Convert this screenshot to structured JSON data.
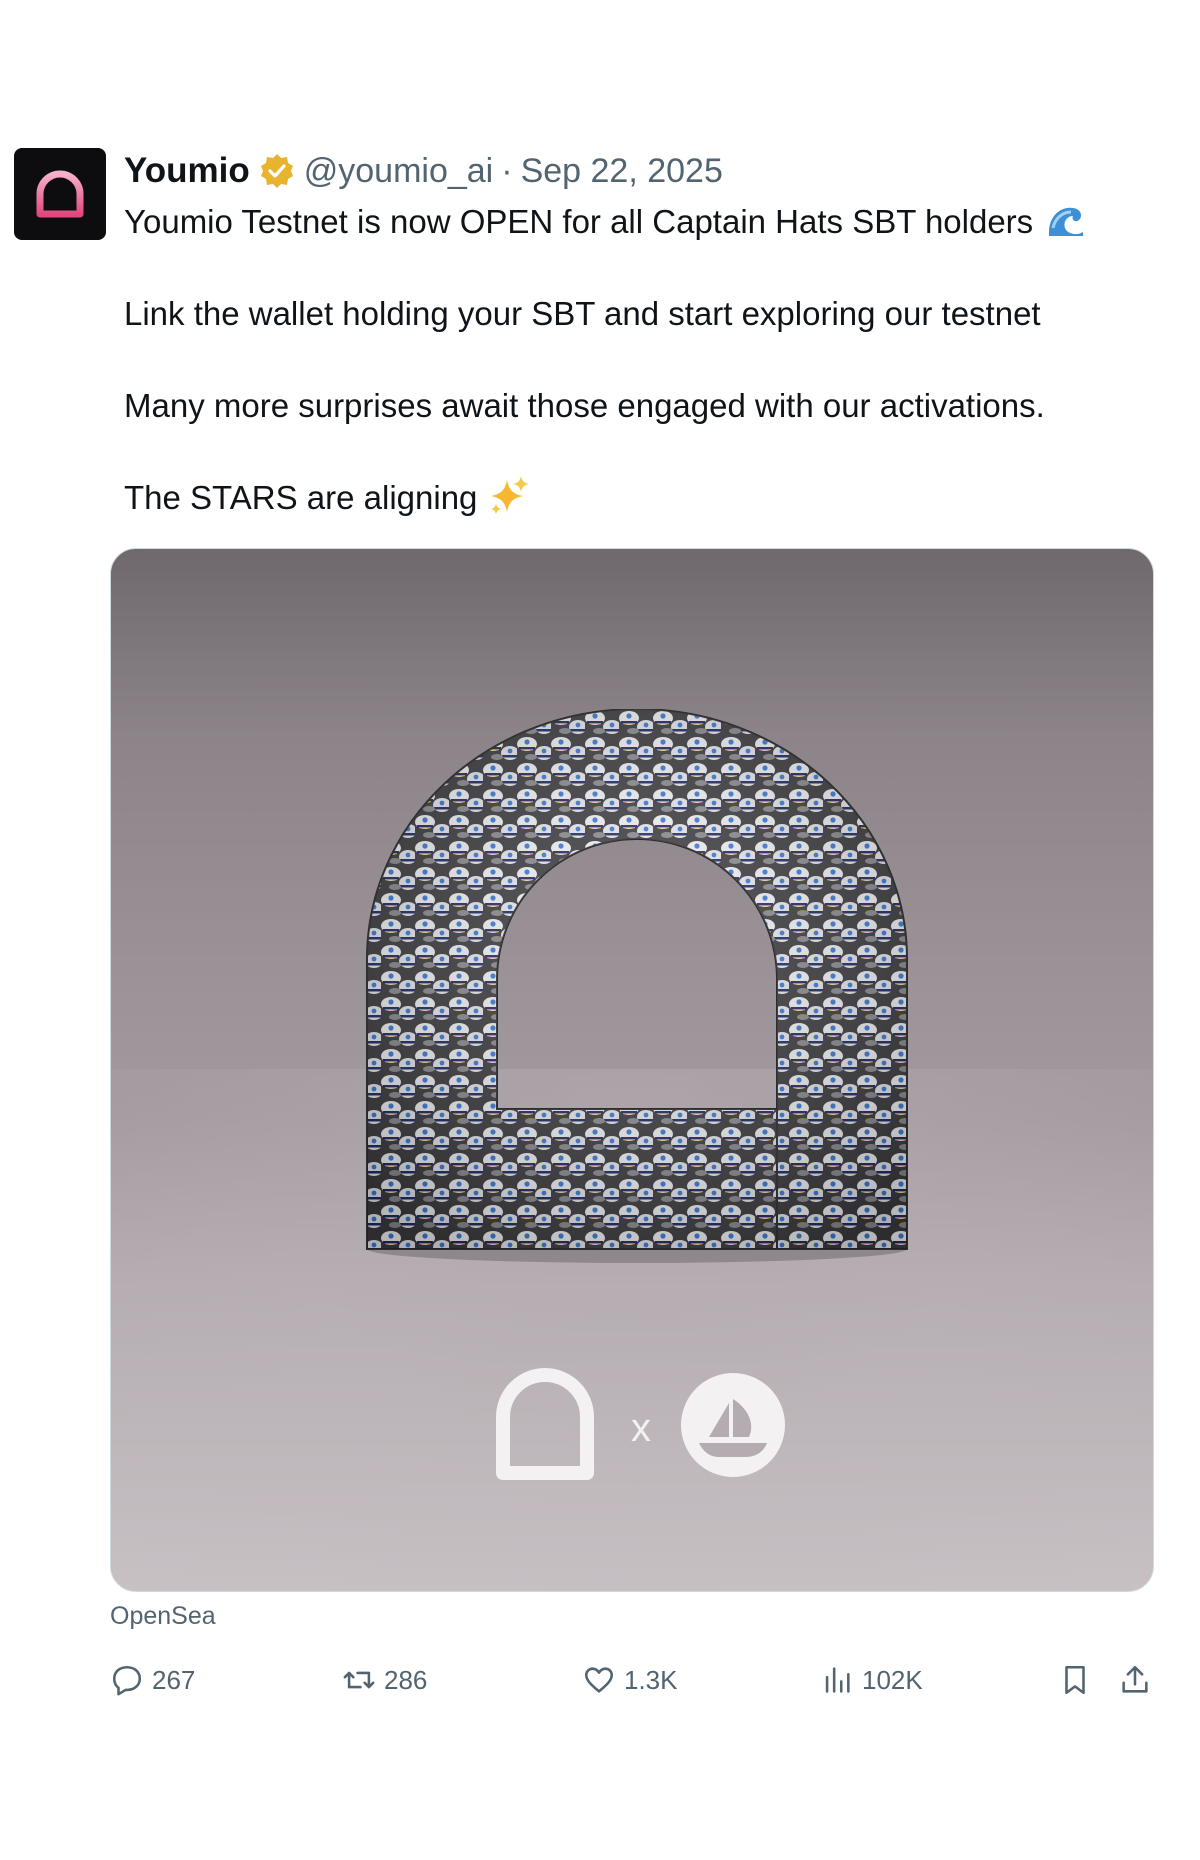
{
  "author": {
    "display_name": "Youmio",
    "handle": "@youmio_ai",
    "separator": "·",
    "date": "Sep 22, 2025",
    "verified_badge": "gold-verified-badge-icon",
    "avatar_icon": "youmio-logo-icon"
  },
  "body": {
    "line1": "Youmio Testnet is now OPEN for all Captain Hats SBT holders",
    "line1_emoji": "water-wave-emoji",
    "line2": "Link the wallet holding your SBT and start exploring our testnet",
    "line3": "Many more surprises await those engaged with our activations.",
    "line4": "The STARS are aligning",
    "line4_emoji": "sparkles-emoji"
  },
  "media": {
    "description_icon": "captain-hats-arch-image",
    "collab_separator": "x",
    "logo_left": "youmio-logo-icon",
    "logo_right": "opensea-logo-icon"
  },
  "source_label": "OpenSea",
  "actions": {
    "reply_count": "267",
    "repost_count": "286",
    "like_count": "1.3K",
    "views_count": "102K"
  },
  "colors": {
    "text": "#0f1419",
    "secondary": "#536471",
    "badge_gold": "#e8b32e",
    "avatar_bg": "#0d0d0f",
    "avatar_arch": "#f06a9a"
  }
}
